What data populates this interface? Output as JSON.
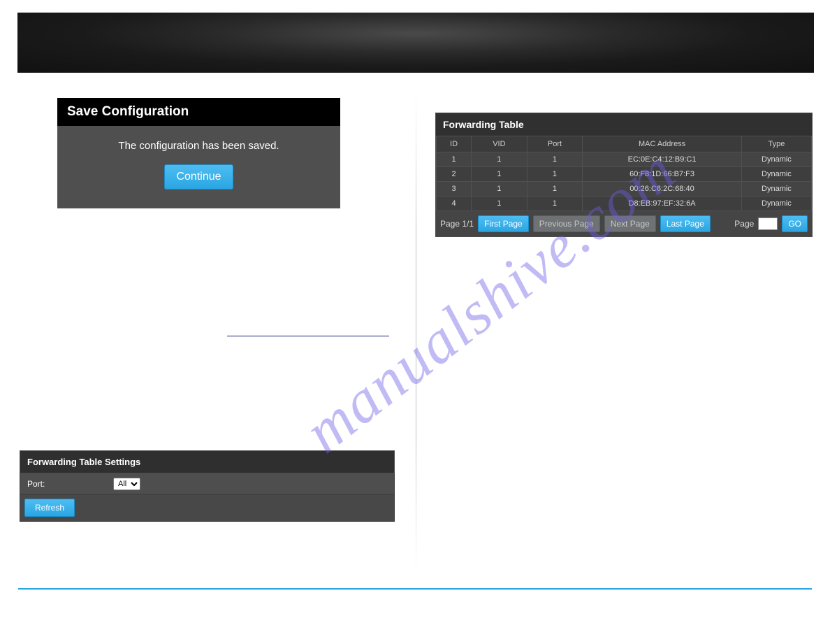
{
  "saveConfig": {
    "title": "Save Configuration",
    "message": "The configuration has been saved.",
    "continue_label": "Continue"
  },
  "fwdSettings": {
    "title": "Forwarding Table Settings",
    "port_label": "Port:",
    "port_value": "All",
    "refresh_label": "Refresh"
  },
  "fwdTable": {
    "title": "Forwarding Table",
    "columns": {
      "id": "ID",
      "vid": "VID",
      "port": "Port",
      "mac": "MAC Address",
      "type": "Type"
    },
    "rows": [
      {
        "id": "1",
        "vid": "1",
        "port": "1",
        "mac": "EC:0E:C4:12:B9:C1",
        "type": "Dynamic"
      },
      {
        "id": "2",
        "vid": "1",
        "port": "1",
        "mac": "60:F8:1D:66:B7:F3",
        "type": "Dynamic"
      },
      {
        "id": "3",
        "vid": "1",
        "port": "1",
        "mac": "00:26:C6:2C:68:40",
        "type": "Dynamic"
      },
      {
        "id": "4",
        "vid": "1",
        "port": "1",
        "mac": "D8:EB:97:EF:32:6A",
        "type": "Dynamic"
      }
    ],
    "pager": {
      "page_text": "Page 1/1",
      "first": "First Page",
      "prev": "Previous Page",
      "next": "Next Page",
      "last": "Last Page",
      "page_label": "Page",
      "page_input": "",
      "go": "GO"
    }
  },
  "watermark": "manualshive.com"
}
